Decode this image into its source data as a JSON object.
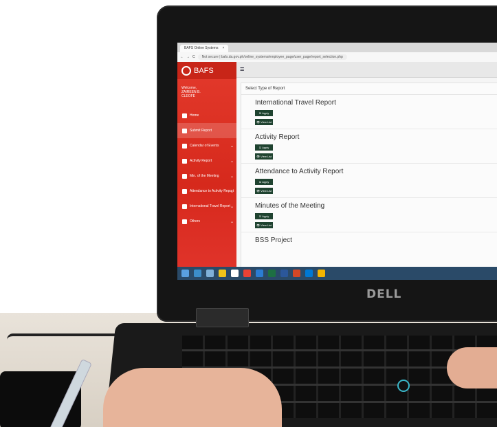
{
  "brand_logo": "DELL",
  "browser": {
    "tab_title": "BAFS Online Systems",
    "tab_close": "×",
    "nav": [
      "←",
      "→",
      "C"
    ],
    "security": "Not secure",
    "url": "bafs.da.gov.ph/online_systems/employee_page/user_page/report_selection.php"
  },
  "app": {
    "logo": "BAFS",
    "welcome_label": "Welcome,",
    "user_line1": "ZAIREEN B.",
    "user_line2": "CLEOFE",
    "menu_icon": "≡",
    "sidebar": [
      {
        "label": "Home",
        "icon": "home-icon"
      },
      {
        "label": "Submit Report",
        "icon": "home-icon"
      },
      {
        "label": "Calendar of Events",
        "icon": "calendar-icon",
        "caret": "⌄"
      },
      {
        "label": "Activity Report",
        "icon": "file-icon",
        "caret": "⌄"
      },
      {
        "label": "Min. of the Meeting",
        "icon": "calendar-icon",
        "caret": "⌄"
      },
      {
        "label": "Attendance to Activity Report",
        "icon": "file-icon",
        "caret": "⌄"
      },
      {
        "label": "International Travel Report",
        "icon": "file-icon",
        "caret": "⌄"
      },
      {
        "label": "Others",
        "icon": "file-icon",
        "caret": "⌄"
      }
    ],
    "card_header": "Select Type of Report",
    "reports": [
      {
        "title": "International Travel Report",
        "apply": "☑ Apply",
        "view": "👁 View List"
      },
      {
        "title": "Activity Report",
        "apply": "☑ Apply",
        "view": "👁 View List"
      },
      {
        "title": "Attendance to Activity Report",
        "apply": "☑ Apply",
        "view": "👁 View List"
      },
      {
        "title": "Minutes of the Meeting",
        "apply": "☑ Apply",
        "view": "👁 View List"
      },
      {
        "title": "BSS Project"
      }
    ]
  },
  "colors": {
    "sidebar_red": "#e33a2c",
    "button_green": "#1f4330",
    "taskbar": "#2a4a68"
  }
}
